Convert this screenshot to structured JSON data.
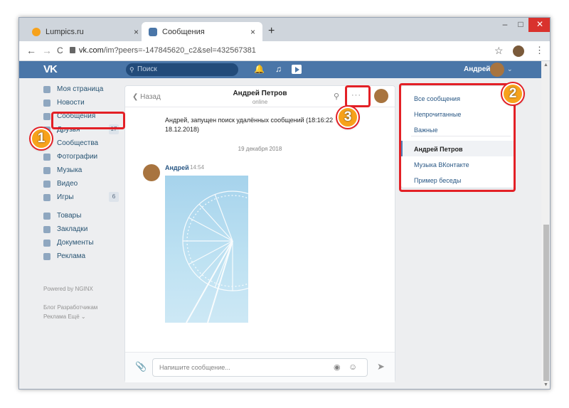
{
  "browser": {
    "tabs": [
      {
        "label": "Lumpics.ru",
        "active": false
      },
      {
        "label": "Сообщения",
        "active": true
      }
    ],
    "tab_close": "×",
    "new_tab": "+",
    "window_buttons": {
      "minimize": "–",
      "maximize": "□",
      "close": "✕"
    },
    "nav": {
      "back": "←",
      "forward": "→",
      "reload": "C"
    },
    "url_host": "vk.com",
    "url_path": "/im?peers=-147845620_c2&sel=432567381",
    "star": "☆",
    "menu": "⋮"
  },
  "vk_header": {
    "logo": "VK",
    "search_placeholder": "Поиск",
    "search_icon": "search-icon",
    "user_name": "Андрей",
    "caret": "⌄"
  },
  "left_menu": {
    "items": [
      {
        "label": "Моя страница",
        "icon": "home-icon",
        "count": ""
      },
      {
        "label": "Новости",
        "icon": "news-icon",
        "count": ""
      },
      {
        "label": "Сообщения",
        "icon": "messages-icon",
        "count": ""
      },
      {
        "label": "Друзья",
        "icon": "friends-icon",
        "count": "17"
      },
      {
        "label": "Сообщества",
        "icon": "communities-icon",
        "count": ""
      },
      {
        "label": "Фотографии",
        "icon": "camera-icon",
        "count": ""
      },
      {
        "label": "Музыка",
        "icon": "music-icon",
        "count": ""
      },
      {
        "label": "Видео",
        "icon": "video-icon",
        "count": ""
      },
      {
        "label": "Игры",
        "icon": "gamepad-icon",
        "count": "6"
      },
      {
        "label": "Товары",
        "icon": "bag-icon",
        "count": ""
      },
      {
        "label": "Закладки",
        "icon": "star-icon",
        "count": ""
      },
      {
        "label": "Документы",
        "icon": "document-icon",
        "count": ""
      },
      {
        "label": "Реклама",
        "icon": "megaphone-icon",
        "count": ""
      }
    ],
    "powered": "Powered by NGINX",
    "footer_line1": "Блог  Разработчикам",
    "footer_line2": "Реклама  Ещё ⌄"
  },
  "chat": {
    "back_label": "Назад",
    "name": "Андрей Петров",
    "status": "online",
    "more": "···",
    "system_message": "Андрей, запущен поиск удалённых сообщений (18:16:22 18.12.2018)",
    "date_separator": "19 декабря 2018",
    "message": {
      "author": "Андрей",
      "time": "14:54"
    },
    "input_placeholder": "Напишите сообщение...",
    "send_icon": "➤"
  },
  "folders": {
    "items": [
      {
        "label": "Все сообщения",
        "active": false
      },
      {
        "label": "Непрочитанные",
        "active": false
      },
      {
        "label": "Важные",
        "active": false
      },
      {
        "label": "Андрей Петров",
        "active": true
      },
      {
        "label": "Музыка ВКонтакте",
        "active": false
      },
      {
        "label": "Пример беседы",
        "active": false
      }
    ]
  },
  "annotations": {
    "badge_1": "1",
    "badge_2": "2",
    "badge_3": "3"
  },
  "colors": {
    "vk_blue": "#4a76a8",
    "highlight_red": "#e32026",
    "badge_orange": "#f7a21b"
  }
}
